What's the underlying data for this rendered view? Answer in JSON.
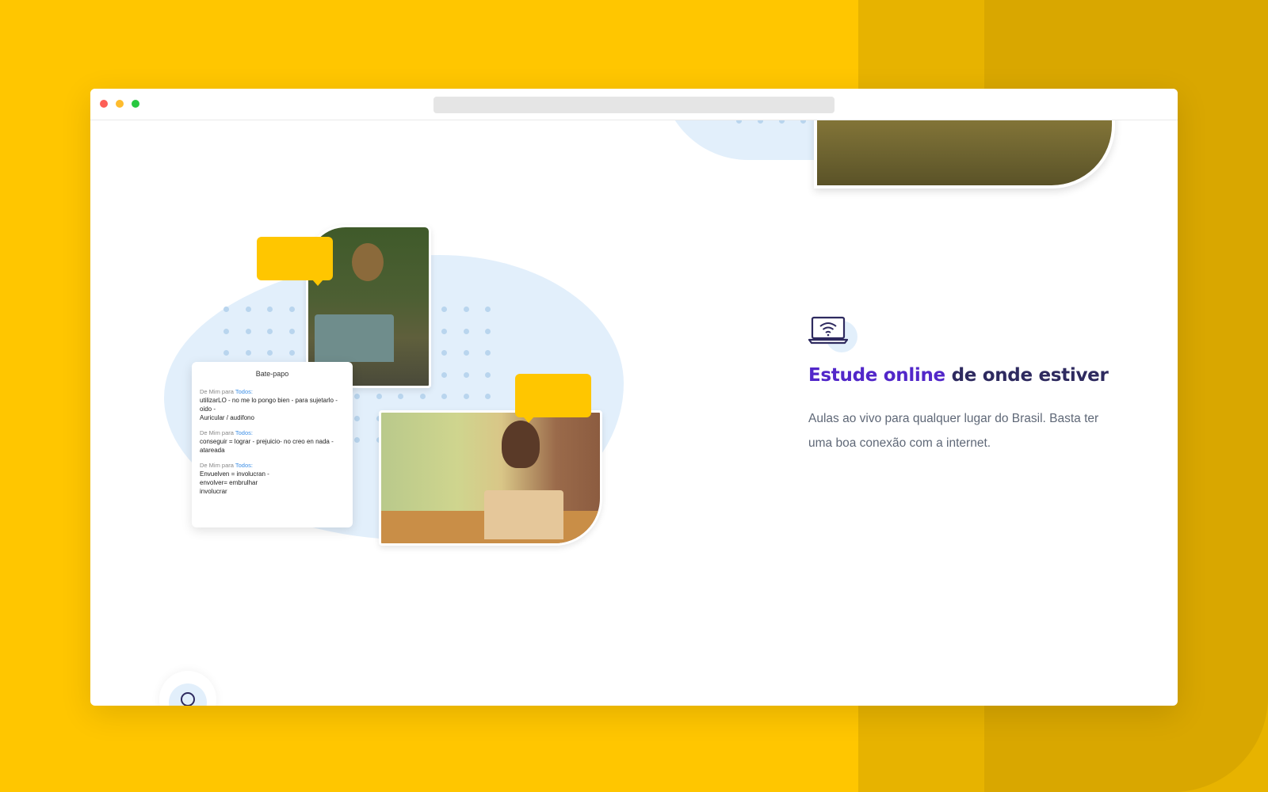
{
  "background": {
    "colors": [
      "#ffc600",
      "#e7b300",
      "#d9a700"
    ]
  },
  "window": {
    "traffic_lights": [
      "close",
      "minimize",
      "maximize"
    ]
  },
  "illustration": {
    "chat": {
      "title": "Bate-papo",
      "messages": [
        {
          "from": "De Mim para ",
          "to": "Todos:",
          "body": "utilizarLO -  no me lo pongo bien - para sujetarlo - oido -\nAuricular / audifono"
        },
        {
          "from": "De Mim para ",
          "to": "Todos:",
          "body": "conseguir = lograr -  prejuicio-  no creo en nada -\natareada"
        },
        {
          "from": "De Mim para ",
          "to": "Todos:",
          "body": "Envuelven = involucran -\nenvolver= embrulhar\ninvolucrar"
        }
      ]
    }
  },
  "feature": {
    "icon": "laptop-wifi-icon",
    "title_accent": "Estude online",
    "title_rest": " de onde estiver",
    "description": "Aulas ao vivo para qualquer lugar do Brasil. Basta ter uma boa conexão com a internet."
  },
  "colors": {
    "accent": "#5227c9",
    "heading": "#2e2a5f",
    "text": "#5f6877",
    "blob": "#e2effb",
    "bubble": "#ffc600"
  }
}
